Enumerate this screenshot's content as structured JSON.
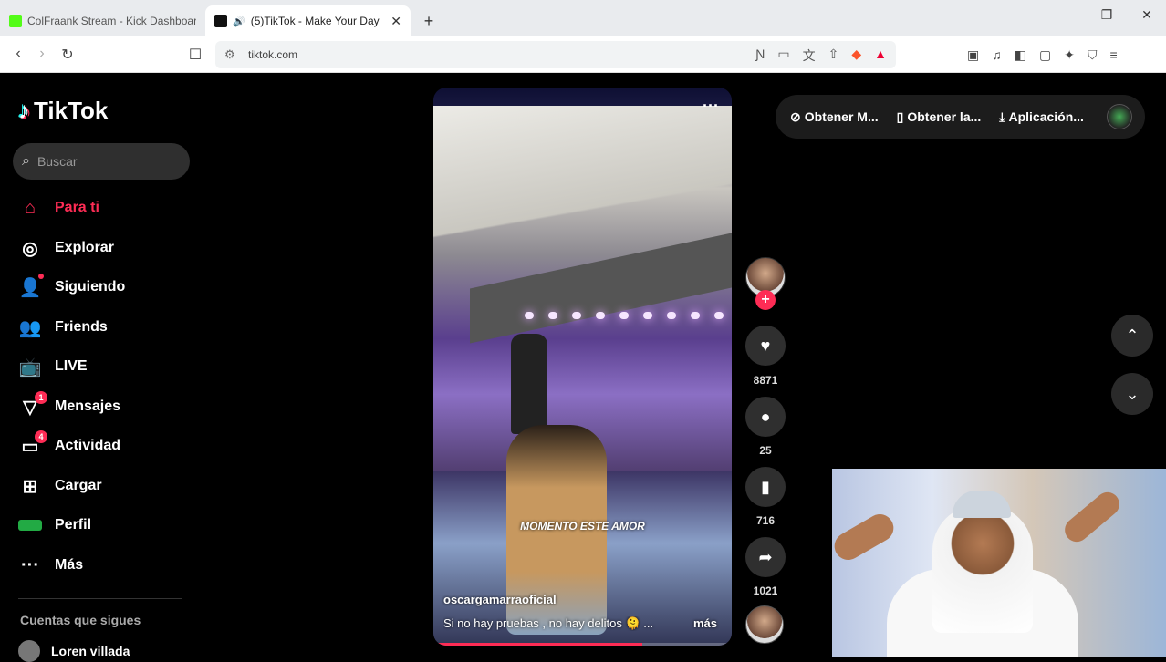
{
  "browser": {
    "tabs": [
      {
        "title": "ColFraank Stream - Kick Dashboard",
        "favicon_color": "#53fc18"
      },
      {
        "title": "(5)TikTok - Make Your Day",
        "favicon_color": "#000000"
      }
    ],
    "new_tab": "+",
    "url": "tiktok.com",
    "window_controls": {
      "minimize": "—",
      "maximize": "❐",
      "close": "✕"
    }
  },
  "sidebar": {
    "logo": "TikTok",
    "search_placeholder": "Buscar",
    "nav": [
      {
        "label": "Para ti",
        "icon": "home-icon",
        "active": true
      },
      {
        "label": "Explorar",
        "icon": "compass-icon"
      },
      {
        "label": "Siguiendo",
        "icon": "following-icon"
      },
      {
        "label": "Friends",
        "icon": "friends-icon"
      },
      {
        "label": "LIVE",
        "icon": "live-icon"
      },
      {
        "label": "Mensajes",
        "icon": "messages-icon",
        "badge": "1"
      },
      {
        "label": "Actividad",
        "icon": "activity-icon",
        "badge": "4"
      },
      {
        "label": "Cargar",
        "icon": "upload-icon"
      },
      {
        "label": "Perfil",
        "icon": "profile-icon"
      },
      {
        "label": "Más",
        "icon": "more-icon"
      }
    ],
    "following_title": "Cuentas que sigues",
    "following": [
      {
        "name": "Loren villada"
      }
    ]
  },
  "video": {
    "overlay_caption": "MOMENTO ESTE AMOR",
    "author": "oscargamarraoficial",
    "description": "Si no hay pruebas , no hay delitos 🫠 ...",
    "more": "más",
    "progress": 0.7
  },
  "actions": {
    "likes": "8871",
    "comments": "25",
    "saves": "716",
    "shares": "1021"
  },
  "top_bar": {
    "items": [
      "Obtener M...",
      "Obtener la...",
      "Aplicación..."
    ]
  },
  "colors": {
    "accent": "#fe2c55",
    "background": "#000000",
    "surface": "#2f2f2f"
  }
}
